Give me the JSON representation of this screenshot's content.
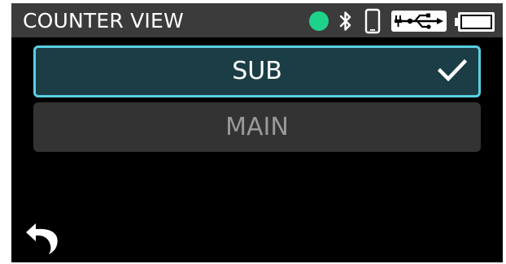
{
  "header": {
    "title": "COUNTER VIEW",
    "icons": [
      "status-dot",
      "bluetooth-icon",
      "phone-icon",
      "usb-icon",
      "battery-icon"
    ],
    "status_dot_color": "#1fd28b"
  },
  "options": [
    {
      "label": "SUB",
      "selected": true
    },
    {
      "label": "MAIN",
      "selected": false
    }
  ],
  "footer": {
    "icon": "back-arrow-icon"
  },
  "colors": {
    "screen_bg": "#000000",
    "header_bg": "#3b3b3b",
    "selected_bg": "#1b3d46",
    "selected_border": "#5ad0e2",
    "unselected_bg": "#333333",
    "selected_text": "#ffffff",
    "unselected_text": "#9a9a9a"
  }
}
